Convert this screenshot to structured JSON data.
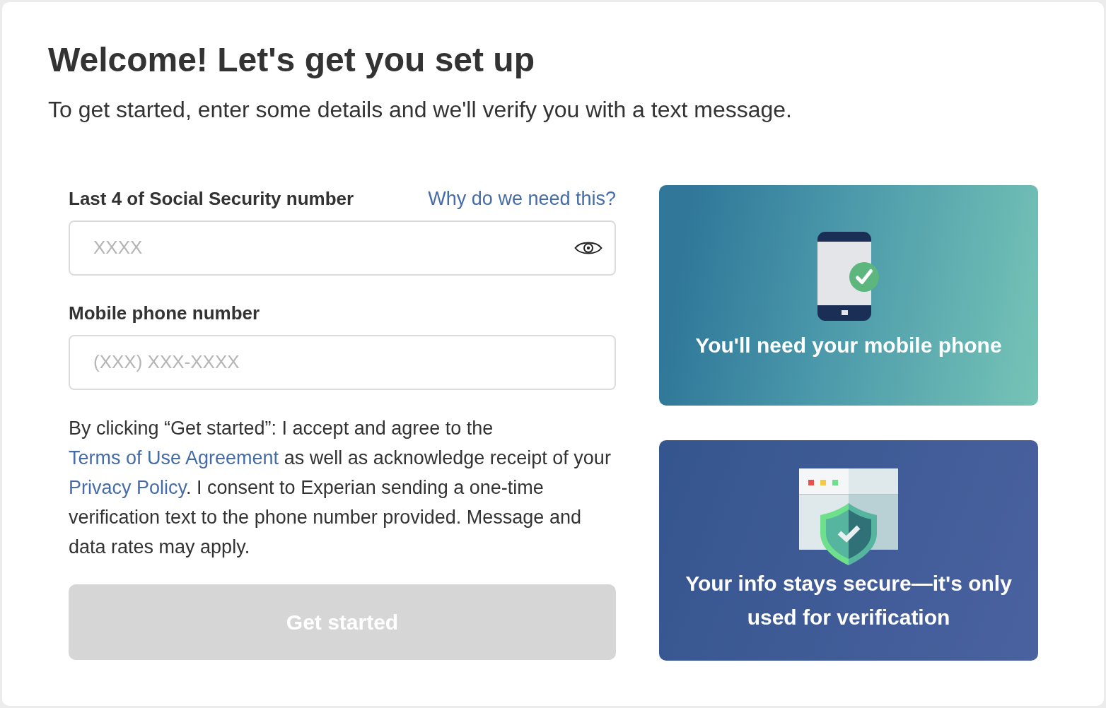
{
  "header": {
    "title": "Welcome! Let's get you set up",
    "subtitle": "To get started, enter some details and we'll verify you with a text message."
  },
  "form": {
    "fields": [
      {
        "kind": "secret",
        "label": "Last 4 of Social Security number",
        "help_link": "Why do we need this?",
        "placeholder": "XXXX"
      },
      {
        "kind": "plain",
        "label": "Mobile phone number",
        "placeholder": "(XXX) XXX-XXXX"
      }
    ],
    "consent": [
      {
        "kind": "text",
        "text": "By clicking “Get started”: I accept and agree to the "
      },
      {
        "kind": "link",
        "text": "Terms of Use Agreement"
      },
      {
        "kind": "text",
        "text": " as well as acknowledge receipt of your "
      },
      {
        "kind": "link",
        "text": "Privacy Policy"
      },
      {
        "kind": "text",
        "text": ". I consent to Experian sending a one-time verification text to the phone number provided. Message and data rates may apply."
      }
    ],
    "submit": {
      "label": "Get started",
      "disabled": true
    }
  },
  "info_cards": [
    {
      "kind": "phone",
      "text": "You'll need your mobile phone"
    },
    {
      "kind": "security",
      "text": "Your info stays secure—it's only used for verification"
    }
  ]
}
